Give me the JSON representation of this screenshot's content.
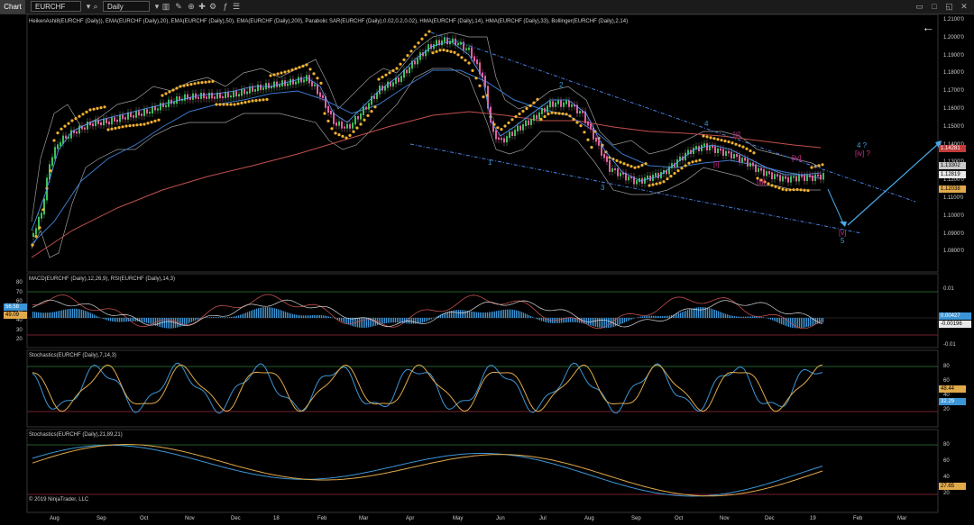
{
  "toolbar": {
    "chart_tab": "Chart",
    "instrument": "EURCHF",
    "period": "Daily"
  },
  "icons": [
    "instrument-dropdown-icon",
    "search-icon",
    "period-dropdown-icon",
    "bar-style-icon",
    "drawing-tool-icon",
    "zoom-icon",
    "crosshair-icon",
    "strategies-icon",
    "indicators-icon",
    "properties-icon",
    "window-close-icon",
    "window-max-icon",
    "window-restore-icon",
    "window-close-x-icon"
  ],
  "main_panel": {
    "indicators_text": "HeikenAshi8(EURCHF (Daily)), EMA(EURCHF (Daily),20), EMA(EURCHF (Daily),50), EMA(EURCHF (Daily),200), Parabolic SAR(EURCHF (Daily),0.02,0.2,0.02), HMA(EURCHF (Daily),14), HMA(EURCHF (Daily),33), Bollinger(EURCHF (Daily),2,14)",
    "price_labels": [
      "1.2100'0",
      "1.2000'0",
      "1.1900'0",
      "1.1800'0",
      "1.1700'0",
      "1.1600'0",
      "1.1500'0",
      "1.1400'0",
      "1.1300'0",
      "1.1200'0",
      "1.1100'0",
      "1.1000'0",
      "1.0900'0",
      "1.0800'0"
    ],
    "badges": [
      {
        "text": "1.14281",
        "color": "#c23a3a"
      },
      {
        "text": "1.13302",
        "color": "#c9c9c9"
      },
      {
        "text": "1.12819",
        "color": "#e8e8e8"
      },
      {
        "text": "1.12038",
        "color": "#e0a94a"
      }
    ],
    "waves_blue": [
      "1",
      "2",
      "3",
      "4",
      "4 ?",
      "5"
    ],
    "waves_magenta": [
      "[i]",
      "[ii]",
      "[iii]",
      "[iv]",
      "[iv] ?",
      "[v]"
    ]
  },
  "macd_panel": {
    "title": "MACD(EURCHF (Daily),12,26,9), RSI(EURCHF (Daily),14,3)",
    "left_labels": [
      "80",
      "70",
      "60",
      "50",
      "40",
      "30",
      "20"
    ],
    "right_labels": [
      "0.01",
      "0",
      "-0.01"
    ],
    "left_badges": [
      {
        "text": "56.58",
        "color": "#3c95d6"
      },
      {
        "text": "49.09",
        "color": "#e0a94a"
      }
    ],
    "right_badges": [
      {
        "text": "0.00427",
        "color": "#3c95d6"
      },
      {
        "text": "-0.00196",
        "color": "#e8e8e8"
      }
    ]
  },
  "stoch1_panel": {
    "title": "Stochastics(EURCHF (Daily),7,14,3)",
    "right_labels": [
      "80",
      "60",
      "40",
      "20"
    ],
    "badges": [
      {
        "text": "48.44",
        "color": "#e0a94a"
      },
      {
        "text": "32.29",
        "color": "#3c95d6"
      }
    ]
  },
  "stoch2_panel": {
    "title": "Stochastics(EURCHF (Daily),21,89,21)",
    "right_labels": [
      "80",
      "60",
      "40",
      "20"
    ],
    "badges": [
      {
        "text": "27.65",
        "color": "#e0a94a"
      }
    ]
  },
  "x_axis": [
    "Aug",
    "Sep",
    "Oct",
    "Nov",
    "Dec",
    "18",
    "Feb",
    "Mar",
    "Apr",
    "May",
    "Jun",
    "Jul",
    "Aug",
    "Sep",
    "Oct",
    "Nov",
    "Dec",
    "19",
    "Feb",
    "Mar"
  ],
  "copyright": "© 2019 NinjaTrader, LLC",
  "colors": {
    "sar": "#f0b030",
    "ema200": "#c0504d",
    "ema50": "#3a78c8",
    "hma": "#5aa0ff",
    "bollinger": "#9a9a9a",
    "candle_up": "#3fbf5a",
    "candle_down": "#e060a0",
    "channel": "#4a7fe0",
    "wave_blue": "#3a9bd8",
    "wave_magenta": "#d0308a",
    "rsi": "#c0504d",
    "stoch_k": "#3c95d6",
    "stoch_d": "#e0a94a"
  }
}
